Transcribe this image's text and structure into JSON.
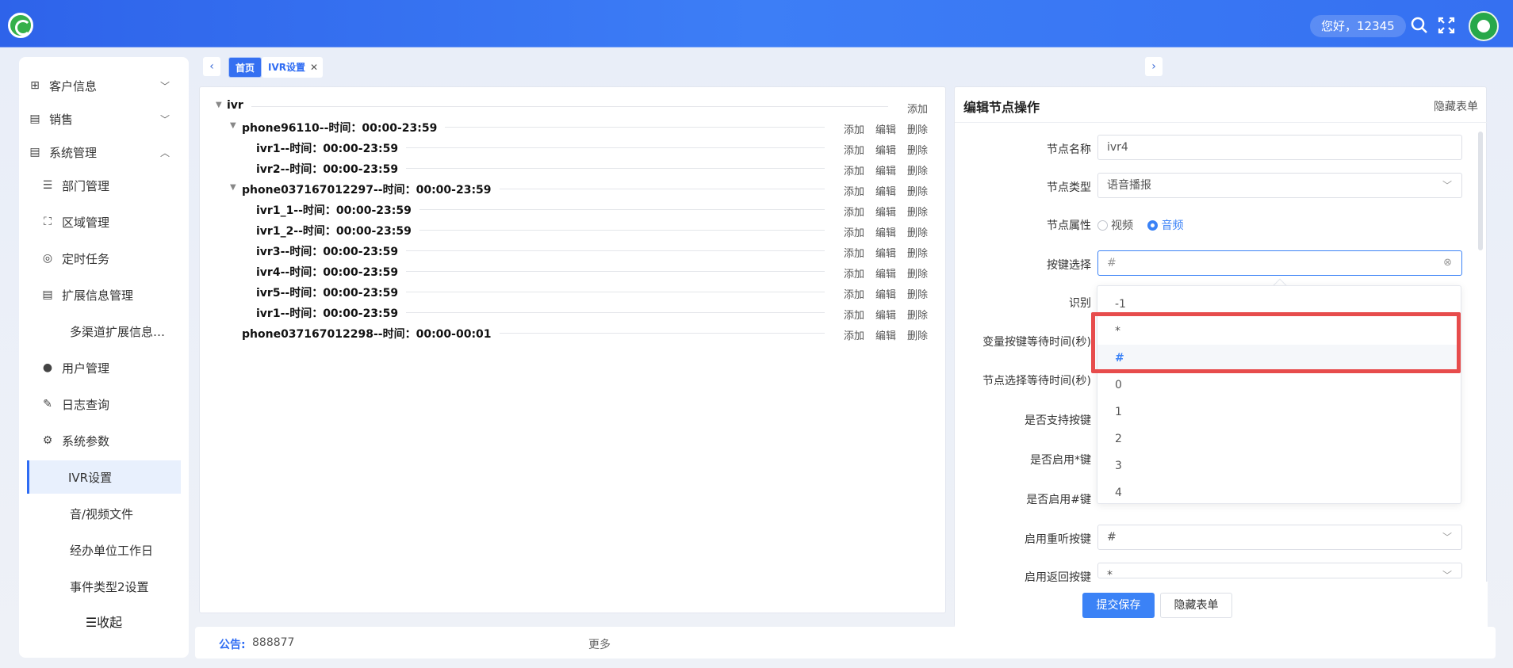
{
  "header": {
    "greeting": "您好，12345",
    "icons": [
      "search-icon",
      "fullscreen-icon",
      "avatar"
    ]
  },
  "sidebar": {
    "items": [
      {
        "label": "客户信息",
        "icon": "grid-icon",
        "chevron": "﹀"
      },
      {
        "label": "销售",
        "icon": "document-icon",
        "chevron": "﹀"
      },
      {
        "label": "系统管理",
        "icon": "settings-doc-icon",
        "chevron": "︿"
      },
      {
        "label": "部门管理",
        "icon": "list-tree-icon"
      },
      {
        "label": "区域管理",
        "icon": "org-chart-icon"
      },
      {
        "label": "定时任务",
        "icon": "clock-icon"
      },
      {
        "label": "扩展信息管理",
        "icon": "doc-edit-icon"
      },
      {
        "label": "多渠道扩展信息…"
      },
      {
        "label": "用户管理",
        "icon": "user-icon"
      },
      {
        "label": "日志查询",
        "icon": "log-icon"
      },
      {
        "label": "系统参数",
        "icon": "gear-icon"
      },
      {
        "label": "IVR设置"
      },
      {
        "label": "音/视频文件"
      },
      {
        "label": "经办单位工作日"
      },
      {
        "label": "事件类型2设置"
      }
    ],
    "collapse_label": "☰收起"
  },
  "tabs": {
    "home": "首页",
    "ivr": "IVR设置"
  },
  "tree": {
    "actions": {
      "add": "添加",
      "edit": "编辑",
      "delete": "删除"
    },
    "root": "ivr",
    "nodes": [
      "phone96110--时间：00:00-23:59",
      "ivr1--时间：00:00-23:59",
      "ivr2--时间：00:00-23:59",
      "phone037167012297--时间：00:00-23:59",
      "ivr1_1--时间：00:00-23:59",
      "ivr1_2--时间：00:00-23:59",
      "ivr3--时间：00:00-23:59",
      "ivr4--时间：00:00-23:59",
      "ivr5--时间：00:00-23:59",
      "ivr1--时间：00:00-23:59",
      "phone037167012298--时间：00:00-00:01"
    ]
  },
  "form": {
    "title": "编辑节点操作",
    "hide_link": "隐藏表单",
    "fields": {
      "node_name": {
        "label": "节点名称",
        "value": "ivr4"
      },
      "node_type": {
        "label": "节点类型",
        "value": "语音播报"
      },
      "node_attr": {
        "label": "节点属性",
        "options": [
          "视频",
          "音频"
        ],
        "selected": "音频"
      },
      "key_select": {
        "label": "按键选择",
        "placeholder": "#"
      },
      "recognize": {
        "label": "识别"
      },
      "var_key_wait": {
        "label": "变量按键等待时间(秒)"
      },
      "node_select_wait": {
        "label": "节点选择等待时间(秒)"
      },
      "support_key": {
        "label": "是否支持按键"
      },
      "enable_star": {
        "label": "是否启用*键"
      },
      "enable_hash": {
        "label": "是否启用#键"
      },
      "replay_key": {
        "label": "启用重听按键",
        "value": "#"
      },
      "return_key": {
        "label": "启用返回按键",
        "value": "*"
      }
    },
    "submit": "提交保存",
    "hide_button": "隐藏表单"
  },
  "dropdown": {
    "options": [
      "-1",
      "*",
      "#",
      "0",
      "1",
      "2",
      "3",
      "4"
    ],
    "selected": "#"
  },
  "notice": {
    "label": "公告:",
    "text": "888877",
    "more": "更多"
  }
}
